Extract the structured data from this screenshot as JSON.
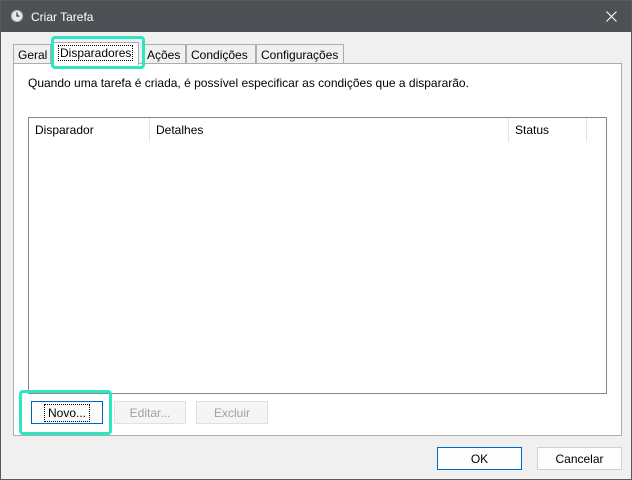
{
  "window": {
    "title": "Criar Tarefa",
    "icon": "task-scheduler-icon",
    "close_icon": "close-icon"
  },
  "tabs": [
    {
      "label": "Geral",
      "active": false
    },
    {
      "label": "Disparadores",
      "active": true
    },
    {
      "label": "Ações",
      "active": false
    },
    {
      "label": "Condições",
      "active": false
    },
    {
      "label": "Configurações",
      "active": false
    }
  ],
  "panel": {
    "description": "Quando uma tarefa é criada, é possível especificar as condições que a dispararão.",
    "columns": [
      "Disparador",
      "Detalhes",
      "Status"
    ],
    "rows": []
  },
  "buttons": {
    "novo": "Novo...",
    "editar": "Editar...",
    "excluir": "Excluir",
    "ok": "OK",
    "cancelar": "Cancelar"
  },
  "highlight_color": "#2ee6c2"
}
